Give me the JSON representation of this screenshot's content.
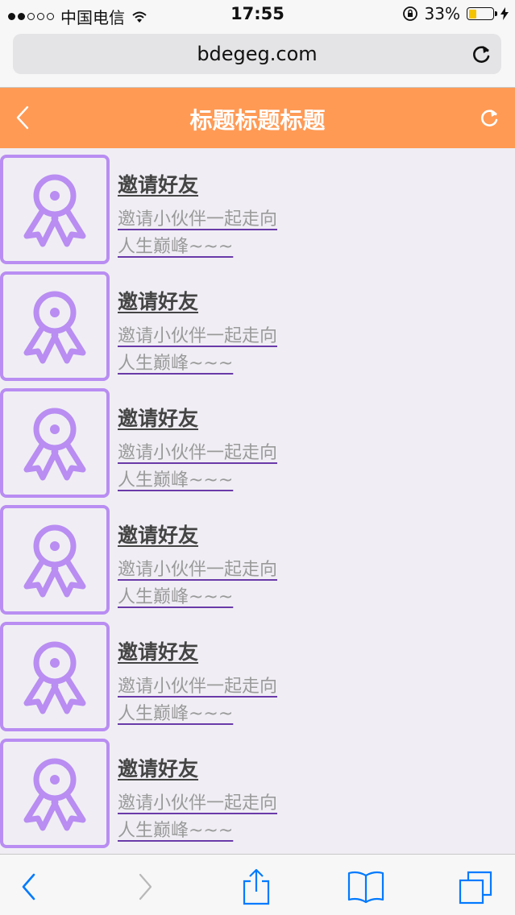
{
  "status_bar": {
    "carrier": "中国电信",
    "time": "17:55",
    "battery_percent": "33%",
    "battery_level": 0.33,
    "signal_bars_filled": 2,
    "signal_bars_total": 5
  },
  "browser": {
    "url": "bdegeg.com"
  },
  "header": {
    "title": "标题标题标题",
    "background_color": "#ff9a55"
  },
  "list": {
    "items": [
      {
        "title": "邀请好友",
        "description": "邀请小伙伴一起走向人生巅峰~~~",
        "icon": "award-ribbon-icon"
      },
      {
        "title": "邀请好友",
        "description": "邀请小伙伴一起走向人生巅峰~~~",
        "icon": "award-ribbon-icon"
      },
      {
        "title": "邀请好友",
        "description": "邀请小伙伴一起走向人生巅峰~~~",
        "icon": "award-ribbon-icon"
      },
      {
        "title": "邀请好友",
        "description": "邀请小伙伴一起走向人生巅峰~~~",
        "icon": "award-ribbon-icon"
      },
      {
        "title": "邀请好友",
        "description": "邀请小伙伴一起走向人生巅峰~~~",
        "icon": "award-ribbon-icon"
      },
      {
        "title": "邀请好友",
        "description": "邀请小伙伴一起走向人生巅峰~~~",
        "icon": "award-ribbon-icon"
      }
    ]
  },
  "toolbar": {
    "buttons": [
      "back-icon",
      "forward-icon",
      "share-icon",
      "bookmarks-icon",
      "tabs-icon"
    ],
    "accent_color": "#007aff"
  }
}
